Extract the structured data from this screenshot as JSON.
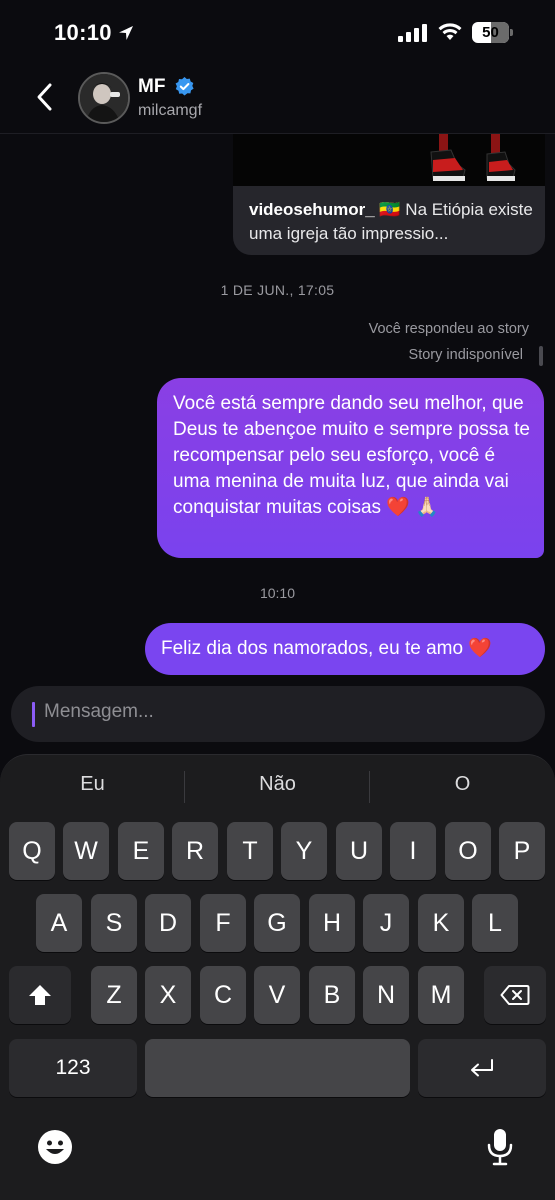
{
  "status_bar": {
    "time": "10:10",
    "battery": "50"
  },
  "header": {
    "name": "MF",
    "handle": "milcamgf"
  },
  "messages": {
    "shared_post": {
      "username": "videosehumor_",
      "emoji": "🇪🇹",
      "text": "Na Etiópia existe uma igreja tão impressio..."
    },
    "timestamp_1": "1 DE JUN., 17:05",
    "replied_label": "Você respondeu ao story",
    "story_status": "Story indisponível",
    "bubble_1": "Você está sempre dando seu melhor, que Deus te abençoe muito e sempre possa te recompensar pelo seu esforço, você é uma menina de muita luz, que ainda vai conquistar muitas coisas ❤️ 🙏🏻",
    "timestamp_2": "10:10",
    "bubble_2": "Feliz dia dos namorados, eu te amo ❤️"
  },
  "composer": {
    "placeholder": "Mensagem..."
  },
  "keyboard": {
    "suggestions": [
      "Eu",
      "Não",
      "O"
    ],
    "row1": [
      "Q",
      "W",
      "E",
      "R",
      "T",
      "Y",
      "U",
      "I",
      "O",
      "P"
    ],
    "row2": [
      "A",
      "S",
      "D",
      "F",
      "G",
      "H",
      "J",
      "K",
      "L"
    ],
    "row3": [
      "Z",
      "X",
      "C",
      "V",
      "B",
      "N",
      "M"
    ],
    "numbers_key": "123",
    "icons": [
      "shift-icon",
      "delete-icon",
      "return-icon",
      "emoji-icon",
      "microphone-icon"
    ]
  },
  "colors": {
    "bubble": "#7a45f0",
    "background": "#0b0b0f",
    "verified": "#3897f0"
  }
}
